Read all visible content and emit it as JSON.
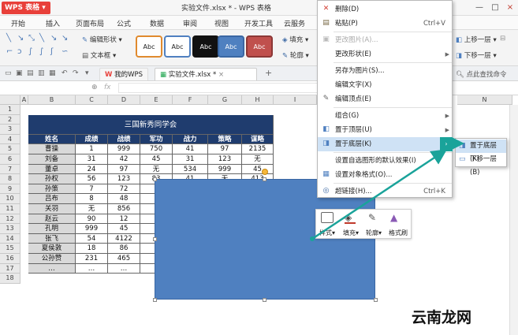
{
  "app": {
    "name": "WPS 表格",
    "doc_title": "实验文件.xlsx * - WPS 表格"
  },
  "window": {
    "min": "—",
    "max": "□",
    "close": "×"
  },
  "menu_tabs": [
    "开始",
    "插入",
    "页面布局",
    "公式",
    "数据",
    "审阅",
    "视图",
    "开发工具",
    "云服务"
  ],
  "ribbon": {
    "edit_shape": "编辑形状",
    "textbox": "文本框",
    "style_label": "Abc",
    "fill": "填充",
    "outline": "轮廓",
    "bring_forward": "上移一层",
    "send_backward": "下移一层",
    "style_colors": [
      "#ffffff",
      "#ffffff",
      "#111111",
      "#4f80c0",
      "#c0504d"
    ],
    "style_borders": [
      "#e08a2e",
      "#4f80c0",
      "#111111",
      "#3a67a3",
      "#8c3836"
    ]
  },
  "quickbar": {
    "tab1": "我的WPS",
    "tab2": "实验文件.xlsx *",
    "add": "+",
    "search": "点此查找命令"
  },
  "formula_bar": {
    "fx": "fx",
    "zoom_icon": "⊕"
  },
  "columns": [
    "A",
    "B",
    "C",
    "D",
    "E",
    "F",
    "G",
    "H",
    "I",
    "N"
  ],
  "rows": [
    "1",
    "2",
    "3",
    "4",
    "5",
    "6",
    "7",
    "8",
    "9",
    "10",
    "11",
    "12",
    "13",
    "14",
    "15",
    "16",
    "17",
    "18"
  ],
  "table": {
    "title": "三国新秀同学会",
    "headers": [
      "姓名",
      "成绩",
      "战绩",
      "军功",
      "战力",
      "策略",
      "谋略"
    ],
    "rows": [
      [
        "曹操",
        "1",
        "999",
        "750",
        "41",
        "97",
        "2135"
      ],
      [
        "刘备",
        "31",
        "42",
        "45",
        "31",
        "123",
        "无"
      ],
      [
        "董卓",
        "24",
        "97",
        "无",
        "534",
        "999",
        "45"
      ],
      [
        "孙权",
        "56",
        "123",
        "83",
        "41",
        "无",
        "413"
      ],
      [
        "孙策",
        "7",
        "72",
        "",
        "",
        "",
        ""
      ],
      [
        "吕布",
        "8",
        "48",
        "",
        "",
        "",
        ""
      ],
      [
        "关羽",
        "无",
        "856",
        "",
        "",
        "",
        ""
      ],
      [
        "赵云",
        "90",
        "12",
        "",
        "",
        "",
        ""
      ],
      [
        "孔明",
        "999",
        "45",
        "",
        "",
        "",
        ""
      ],
      [
        "张飞",
        "54",
        "4122",
        "",
        "",
        "",
        ""
      ],
      [
        "夏侯敦",
        "18",
        "86",
        "",
        "",
        "",
        ""
      ],
      [
        "公孙赞",
        "231",
        "465",
        "",
        "",
        "",
        ""
      ],
      [
        "…",
        "…",
        "…",
        "",
        "",
        "",
        ""
      ]
    ]
  },
  "mini_toolbar": {
    "style": "样式",
    "fill": "填充",
    "outline": "轮廓",
    "format_painter": "格式刷"
  },
  "context_menu": [
    {
      "label": "删除(D)",
      "shortcut": "",
      "icon": "✕",
      "icon_color": "#d23b2f",
      "disabled": false,
      "arrow": false
    },
    {
      "label": "粘贴(P)",
      "shortcut": "Ctrl+V",
      "icon": "▤",
      "icon_color": "#7a6a45",
      "disabled": false,
      "arrow": false
    },
    {
      "sep": true
    },
    {
      "label": "更改图片(A)...",
      "shortcut": "",
      "icon": "▣",
      "icon_color": "#bbbbbb",
      "disabled": true,
      "arrow": false
    },
    {
      "label": "更改形状(E)",
      "shortcut": "",
      "icon": "",
      "icon_color": "#888888",
      "disabled": false,
      "arrow": true
    },
    {
      "sep": true
    },
    {
      "label": "另存为图片(S)...",
      "shortcut": "",
      "icon": "",
      "icon_color": "#888888",
      "disabled": false,
      "arrow": false
    },
    {
      "label": "编辑文字(X)",
      "shortcut": "",
      "icon": "",
      "icon_color": "#888888",
      "disabled": false,
      "arrow": false
    },
    {
      "label": "编辑顶点(E)",
      "shortcut": "",
      "icon": "✎",
      "icon_color": "#666666",
      "disabled": false,
      "arrow": false
    },
    {
      "sep": true
    },
    {
      "label": "组合(G)",
      "shortcut": "",
      "icon": "",
      "icon_color": "#888888",
      "disabled": false,
      "arrow": true
    },
    {
      "label": "置于顶层(U)",
      "shortcut": "",
      "icon": "◧",
      "icon_color": "#4f80c0",
      "disabled": false,
      "arrow": true
    },
    {
      "label": "置于底层(K)",
      "shortcut": "",
      "icon": "◨",
      "icon_color": "#4f80c0",
      "disabled": false,
      "arrow": true,
      "highlight": true
    },
    {
      "sep": true
    },
    {
      "label": "设置自选图形的默认效果(I)",
      "shortcut": "",
      "icon": "",
      "icon_color": "#888888",
      "disabled": false,
      "arrow": false
    },
    {
      "label": "设置对象格式(O)...",
      "shortcut": "",
      "icon": "▦",
      "icon_color": "#4f80c0",
      "disabled": false,
      "arrow": false
    },
    {
      "sep": true
    },
    {
      "label": "超链接(H)...",
      "shortcut": "Ctrl+K",
      "icon": "◎",
      "icon_color": "#3a67a3",
      "disabled": false,
      "arrow": false
    }
  ],
  "submenu": [
    {
      "label": "置于底层(K)",
      "highlight": true
    },
    {
      "label": "下移一层(B)",
      "highlight": false
    }
  ],
  "watermark": "云南龙网",
  "colors": {
    "accent": "#c0392b",
    "header_fill": "#1f3c6e",
    "shape_fill": "#4f80c0",
    "arrow": "#1aa39a",
    "highlight": "#cfe2f5"
  }
}
